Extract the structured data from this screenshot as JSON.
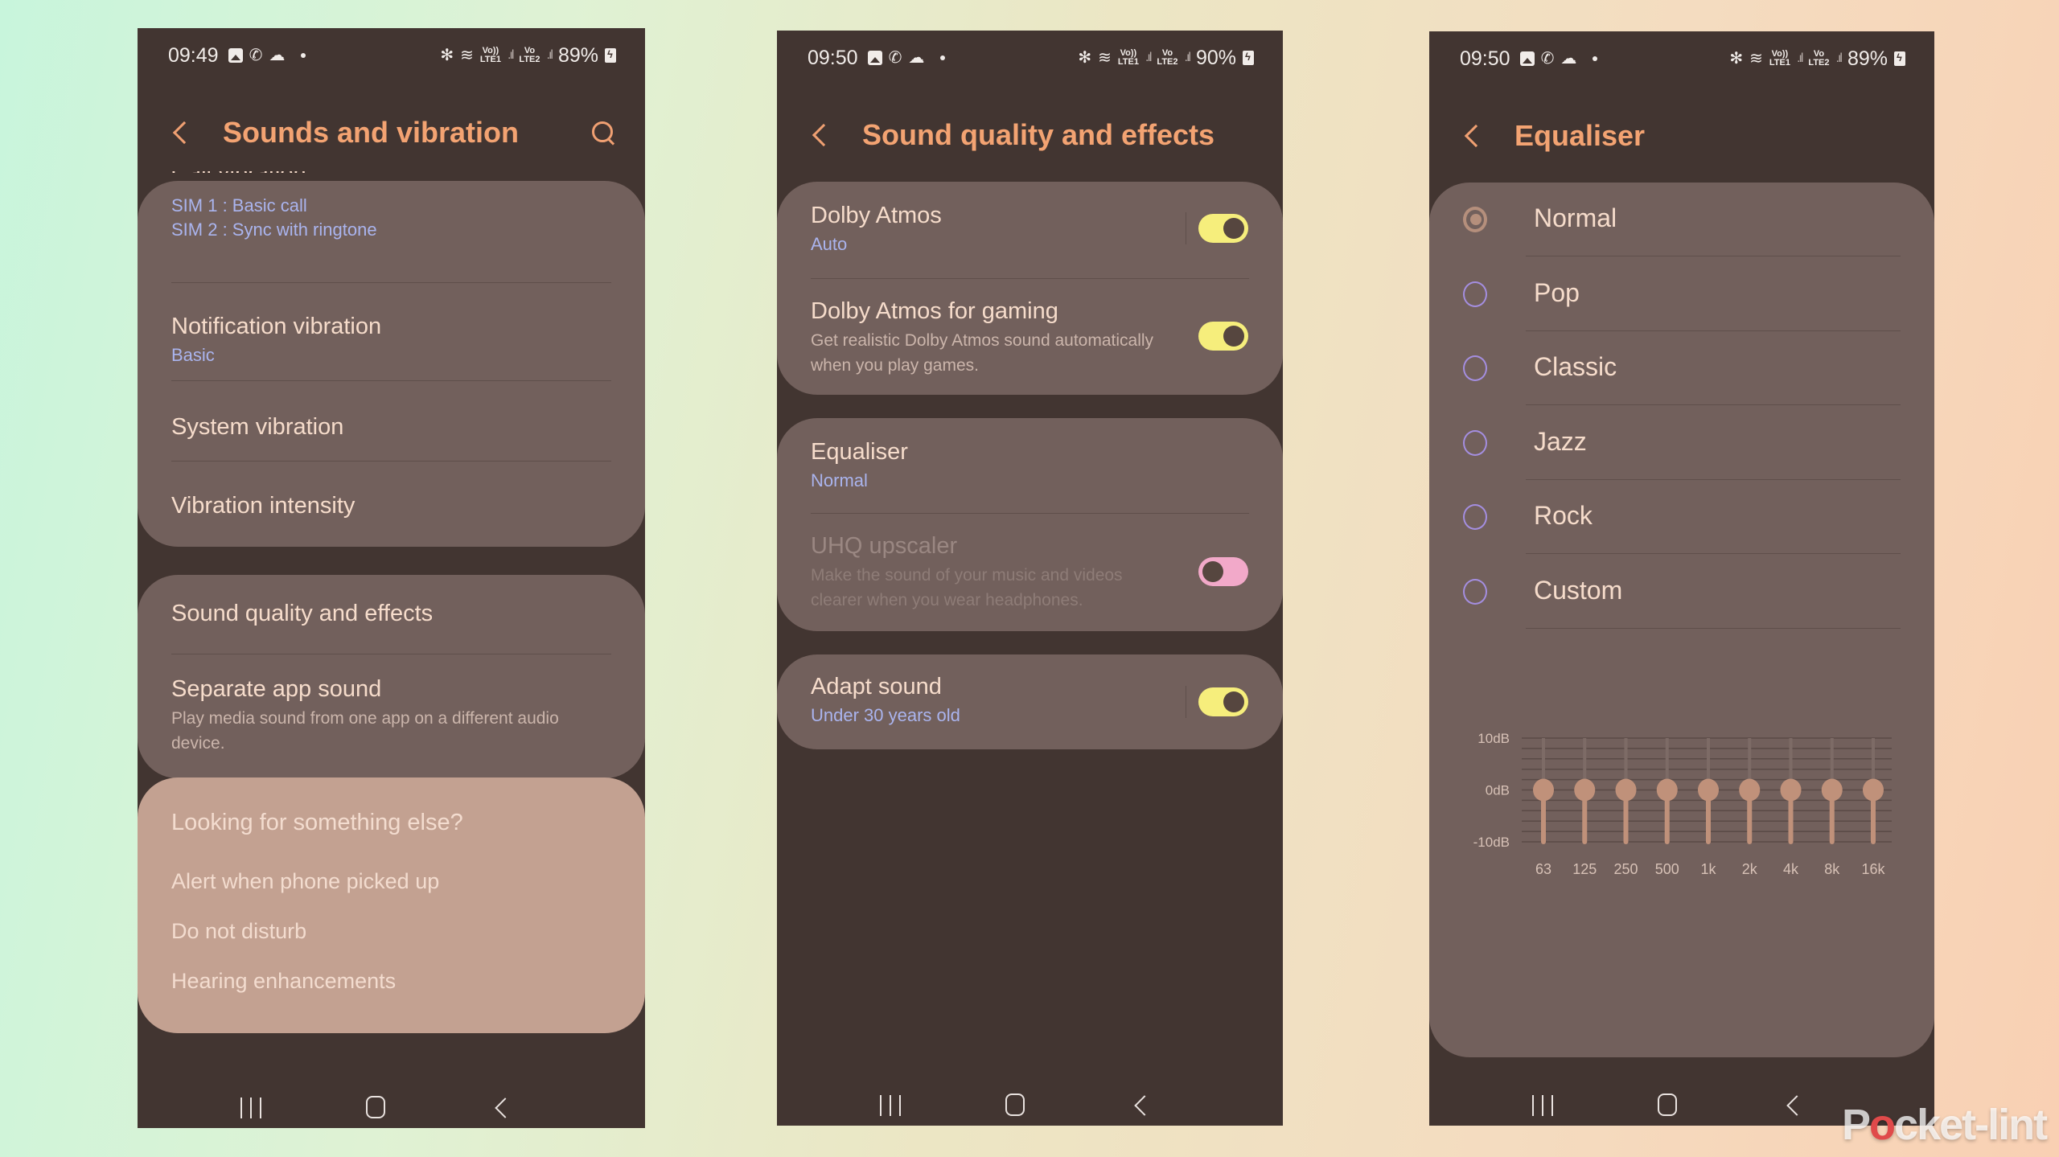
{
  "screens": [
    {
      "status": {
        "time": "09:49",
        "battery": "89%",
        "sim1": "LTE1",
        "sim1_top": "Vo))",
        "sim2": "LTE2",
        "sim2_top": "Vo"
      },
      "title": "Sounds and vibration",
      "partial_item": "Call vibration",
      "group1": [
        {
          "title": "",
          "subs": [
            "SIM 1 : Basic call",
            "SIM 2 : Sync with ringtone"
          ]
        },
        {
          "title": "Notification vibration",
          "sub": "Basic"
        },
        {
          "title": "System vibration"
        },
        {
          "title": "Vibration intensity"
        }
      ],
      "group2": [
        {
          "title": "Sound quality and effects"
        },
        {
          "title": "Separate app sound",
          "desc": "Play media sound from one app on a different audio device."
        }
      ],
      "suggestions": {
        "heading": "Looking for something else?",
        "links": [
          "Alert when phone picked up",
          "Do not disturb",
          "Hearing enhancements"
        ]
      }
    },
    {
      "status": {
        "time": "09:50",
        "battery": "90%",
        "sim1": "LTE1",
        "sim1_top": "Vo))",
        "sim2": "LTE2",
        "sim2_top": "Vo"
      },
      "title": "Sound quality and effects",
      "group1": [
        {
          "title": "Dolby Atmos",
          "sub": "Auto",
          "toggle": true
        },
        {
          "title": "Dolby Atmos for gaming",
          "desc": "Get realistic Dolby Atmos sound automatically when you play games.",
          "toggle": true
        }
      ],
      "group2": [
        {
          "title": "Equaliser",
          "sub": "Normal"
        },
        {
          "title": "UHQ upscaler",
          "desc": "Make the sound of your music and videos clearer when you wear headphones.",
          "toggle": false,
          "disabled": true
        }
      ],
      "group3": [
        {
          "title": "Adapt sound",
          "sub": "Under 30 years old",
          "toggle": true
        }
      ]
    },
    {
      "status": {
        "time": "09:50",
        "battery": "89%",
        "sim1": "LTE1",
        "sim1_top": "Vo))",
        "sim2": "LTE2",
        "sim2_top": "Vo"
      },
      "title": "Equaliser",
      "presets": [
        "Normal",
        "Pop",
        "Classic",
        "Jazz",
        "Rock",
        "Custom"
      ],
      "selected_preset": "Normal"
    }
  ],
  "chart_data": {
    "type": "bar",
    "title": "Equaliser",
    "categories": [
      "63",
      "125",
      "250",
      "500",
      "1k",
      "2k",
      "4k",
      "8k",
      "16k"
    ],
    "values": [
      0,
      0,
      0,
      0,
      0,
      0,
      0,
      0,
      0
    ],
    "ylabel": "",
    "xlabel": "",
    "ylim": [
      -10,
      10
    ],
    "yticks": [
      "10dB",
      "0dB",
      "-10dB"
    ],
    "grid": true
  },
  "colors": {
    "accent": "#f3a372",
    "toggle_on": "#f6ee7c",
    "toggle_off": "#f2a9c9",
    "sub_text": "#aab4ee",
    "slider": "#c0917a"
  },
  "watermark": {
    "pre": "P",
    "o": "o",
    "post": "cket-lint"
  }
}
